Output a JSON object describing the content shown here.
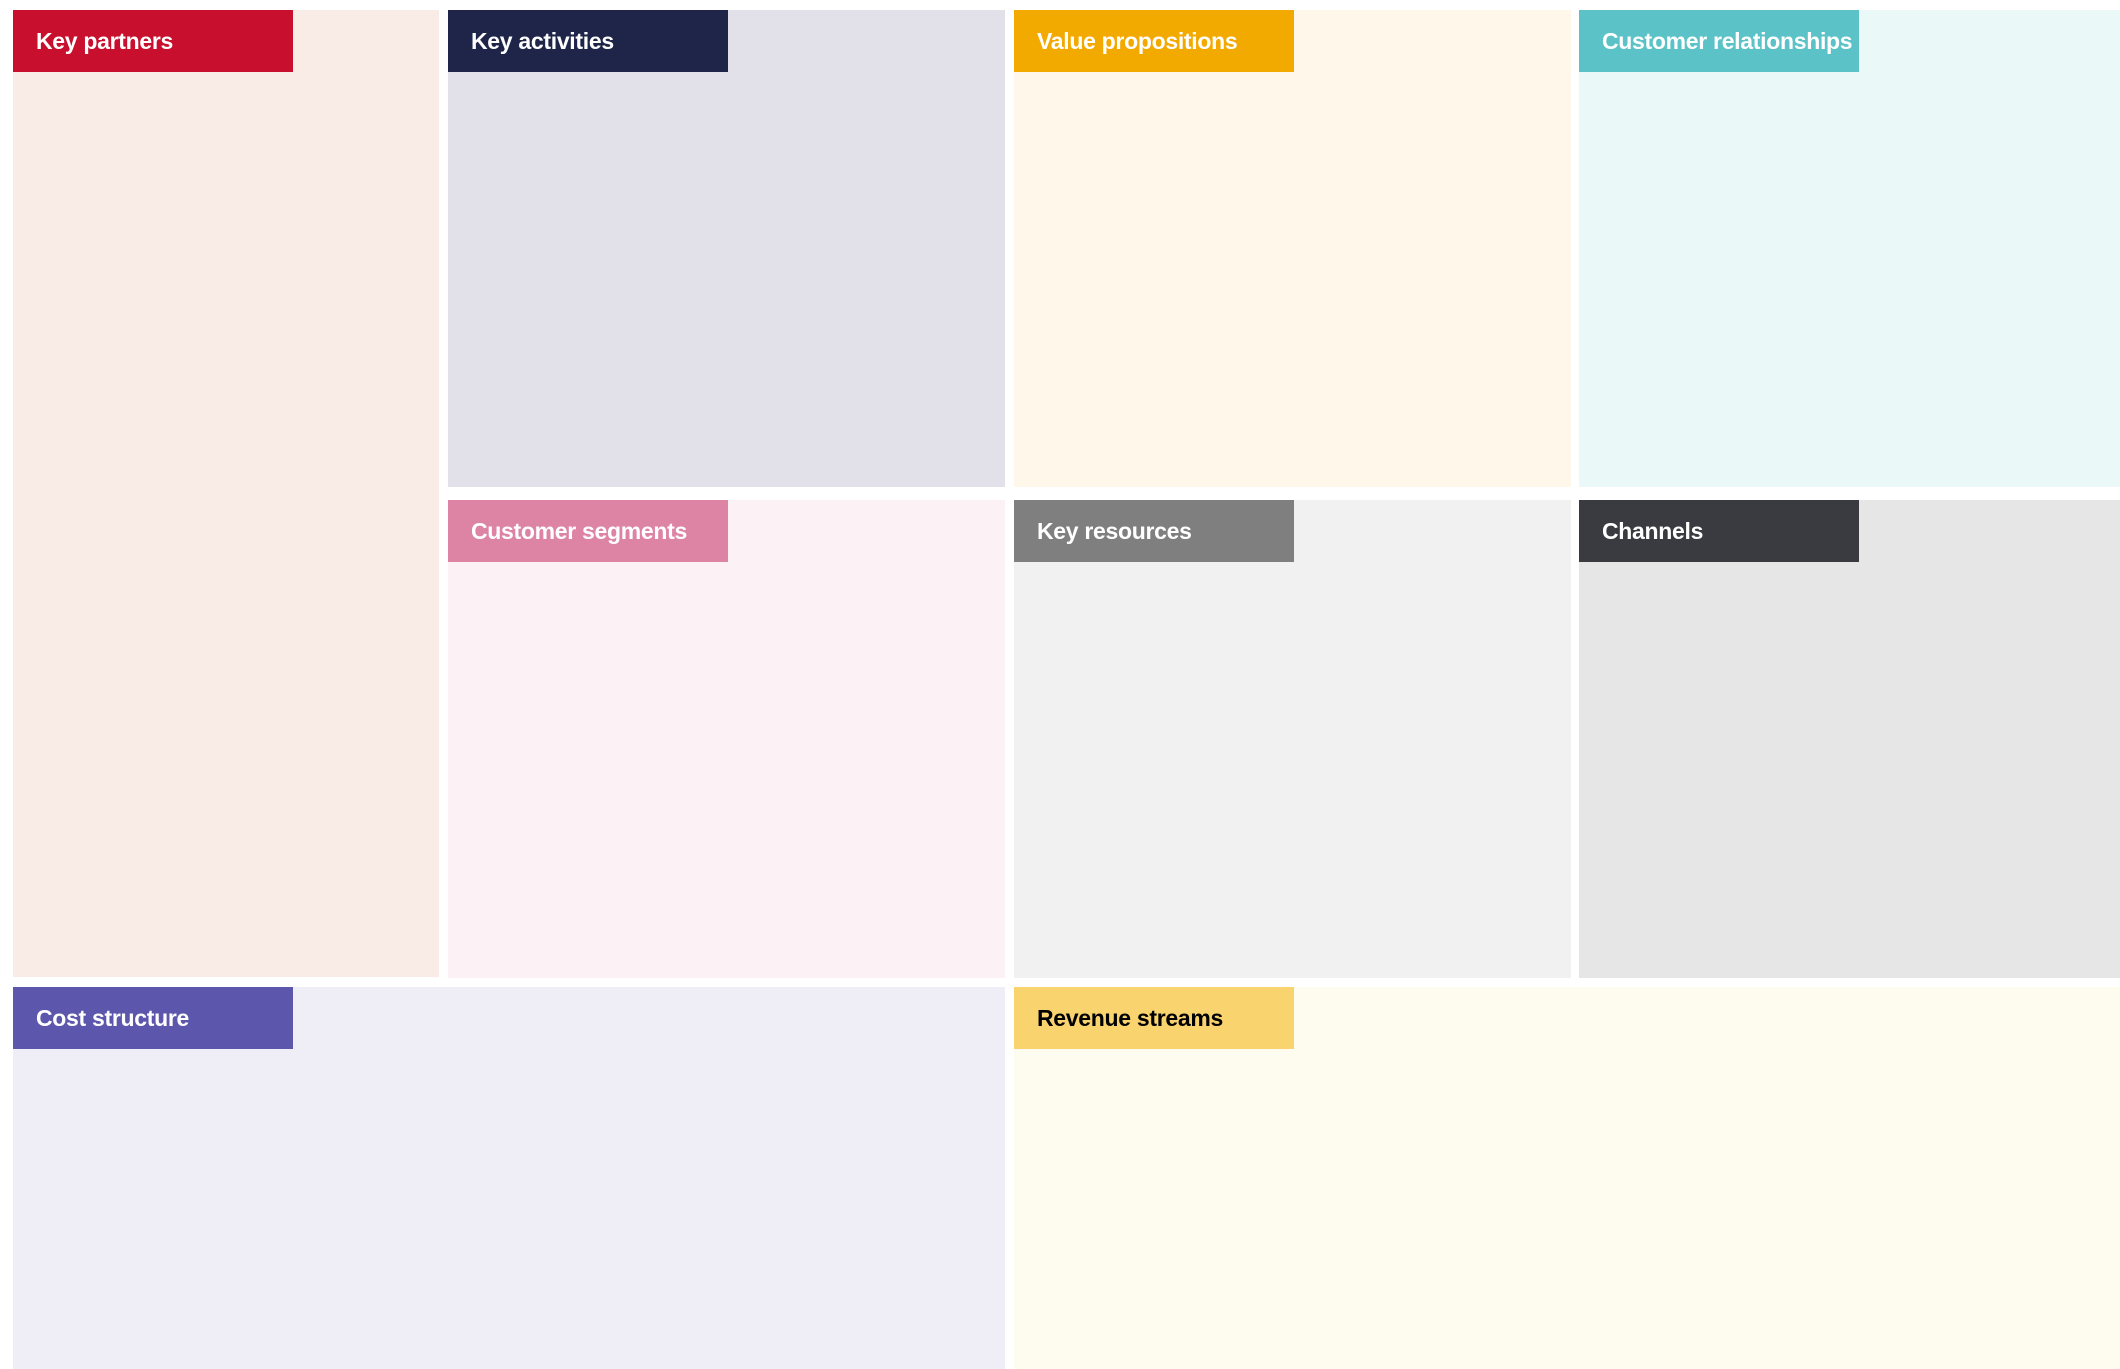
{
  "canvas": {
    "blocks": [
      {
        "id": "partners",
        "label": "Key partners",
        "header_color": "#c8102e",
        "label_color": "#ffffff",
        "bg_color": "#f9ebe6"
      },
      {
        "id": "activities",
        "label": "Key activities",
        "header_color": "#1f2549",
        "label_color": "#ffffff",
        "bg_color": "#e2e1ea"
      },
      {
        "id": "value",
        "label": "Value propositions",
        "header_color": "#f2a900",
        "label_color": "#ffffff",
        "bg_color": "#fff7ea"
      },
      {
        "id": "relationships",
        "label": "Customer relationships",
        "header_color": "#5bc2c7",
        "label_color": "#ffffff",
        "bg_color": "#ebf8f8"
      },
      {
        "id": "segments",
        "label": "Customer segments",
        "header_color": "#dd84a4",
        "label_color": "#ffffff",
        "bg_color": "#fcf2f5"
      },
      {
        "id": "resources",
        "label": "Key resources",
        "header_color": "#7f7f80",
        "label_color": "#ffffff",
        "bg_color": "#f1f1f1"
      },
      {
        "id": "channels",
        "label": "Channels",
        "header_color": "#3a3a41",
        "label_color": "#ffffff",
        "bg_color": "#e6e6e7"
      },
      {
        "id": "cost",
        "label": "Cost structure",
        "header_color": "#5c56ad",
        "label_color": "#ffffff",
        "bg_color": "#efedf6"
      },
      {
        "id": "revenue",
        "label": "Revenue streams",
        "header_color": "#f9d36e",
        "label_color": "#000000",
        "bg_color": "#fefbef"
      }
    ]
  }
}
